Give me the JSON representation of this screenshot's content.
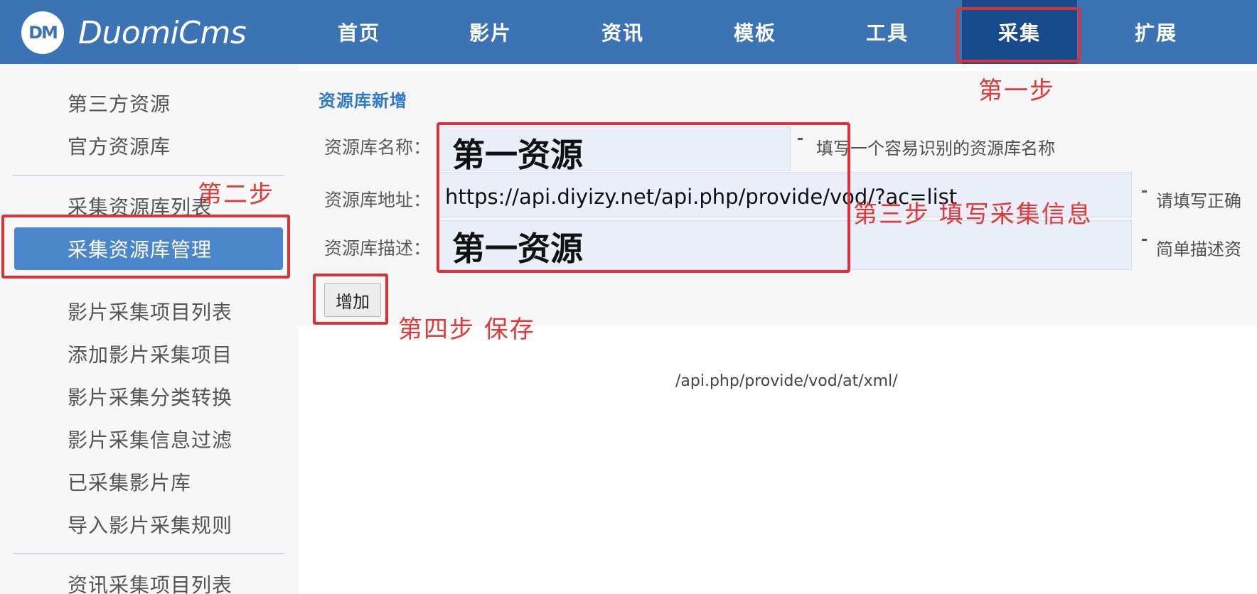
{
  "header": {
    "logo_mark": "DM",
    "logo_text": "DuomiCms",
    "nav": [
      {
        "label": "首页"
      },
      {
        "label": "影片"
      },
      {
        "label": "资讯"
      },
      {
        "label": "模板"
      },
      {
        "label": "工具"
      },
      {
        "label": "采集"
      },
      {
        "label": "扩展"
      }
    ],
    "active_nav": "采集"
  },
  "sidebar": {
    "items": [
      {
        "label": "第三方资源"
      },
      {
        "label": "官方资源库"
      },
      {
        "label": "采集资源库列表"
      },
      {
        "label": "采集资源库管理"
      },
      {
        "label": "影片采集项目列表"
      },
      {
        "label": "添加影片采集项目"
      },
      {
        "label": "影片采集分类转换"
      },
      {
        "label": "影片采集信息过滤"
      },
      {
        "label": "已采集影片库"
      },
      {
        "label": "导入影片采集规则"
      },
      {
        "label": "资讯采集项目列表"
      }
    ],
    "active_item": "采集资源库管理"
  },
  "form": {
    "section_title": "资源库新增",
    "fields": [
      {
        "label": "资源库名称：",
        "value": "第一资源",
        "hint": "填写一个容易识别的资源库名称"
      },
      {
        "label": "资源库地址：",
        "value": "https://api.diyizy.net/api.php/provide/vod/?ac=list",
        "hint": "请填写正确"
      },
      {
        "label": "资源库描述：",
        "value": "第一资源",
        "hint": "简单描述资"
      }
    ],
    "add_button": "增加"
  },
  "annotations": {
    "step1": "第一步",
    "step2": "第二步",
    "step3": "第三步 填写采集信息",
    "step4": "第四步 保存"
  },
  "background_text": "/api.php/provide/vod/at/xml/",
  "colors": {
    "header_bg": "#3b73b4",
    "nav_active_bg": "#174b8c",
    "sidebar_active_bg": "#4a86c9",
    "highlight_red": "#d8323a",
    "annotation_red": "#e03a3a",
    "section_title": "#2f78c8"
  }
}
